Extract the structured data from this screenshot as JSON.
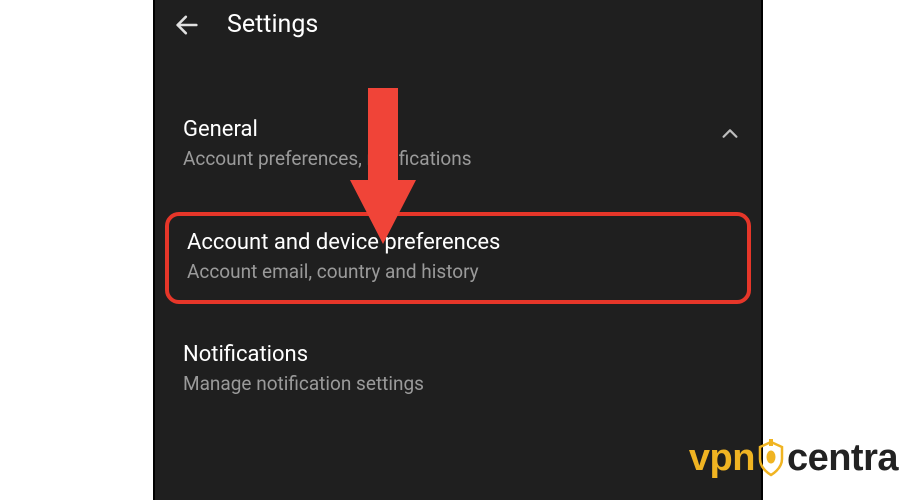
{
  "header": {
    "title": "Settings"
  },
  "sections": {
    "general": {
      "title": "General",
      "subtitle": "Account preferences, notifications"
    },
    "account": {
      "title": "Account and device preferences",
      "subtitle": "Account email, country and history"
    },
    "notifications": {
      "title": "Notifications",
      "subtitle": "Manage notification settings"
    }
  },
  "annotation": {
    "arrow_color": "#f04438",
    "highlight_color": "#e63629"
  },
  "watermark": {
    "part1": "vpn",
    "part2": "centra"
  }
}
